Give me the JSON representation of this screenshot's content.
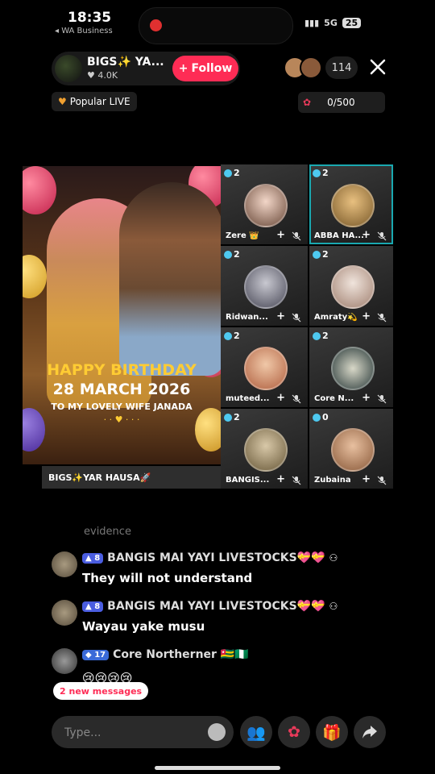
{
  "status_bar": {
    "time": "18:35",
    "back_label": "◂ WA Business",
    "signal": "5G",
    "battery": "25"
  },
  "host": {
    "name": "BIGS✨ YA...",
    "likes": "4.0K",
    "follow_label": "Follow"
  },
  "viewers": {
    "count": "114"
  },
  "popular_badge": "Popular LIVE",
  "rose_goal": "0/500",
  "poster": {
    "title": "HAPPY BIRTHDAY",
    "date": "28 MARCH 2026",
    "subtitle": "TO MY LOVELY WIFE JANADA",
    "host_label": "BIGS✨YAR HAUSA🚀"
  },
  "guests": [
    {
      "gauge": "2",
      "name": "Zere 👑",
      "highlighted": false
    },
    {
      "gauge": "2",
      "name": "ABBA HA...",
      "highlighted": true
    },
    {
      "gauge": "2",
      "name": "Ridwan...",
      "highlighted": false
    },
    {
      "gauge": "2",
      "name": "Amraty💫",
      "highlighted": false
    },
    {
      "gauge": "2",
      "name": "muteed...",
      "highlighted": false
    },
    {
      "gauge": "2",
      "name": "Core N...",
      "highlighted": false
    },
    {
      "gauge": "2",
      "name": "BANGIS...",
      "highlighted": false
    },
    {
      "gauge": "0",
      "name": "Zubaina",
      "highlighted": false
    }
  ],
  "chat": {
    "faded": "evidence",
    "messages": [
      {
        "level": "8",
        "name": "BANGIS MAI YAYI LIVESTOCKS💝💝",
        "text": "They will not understand"
      },
      {
        "level": "8",
        "name": "BANGIS MAI YAYI LIVESTOCKS💝💝",
        "text": "Wayau yake musu"
      },
      {
        "level": "17",
        "name": "Core Northerner 🇹🇬🇳🇬",
        "text": "😢😢😢😢"
      }
    ],
    "new_messages": "2 new messages"
  },
  "input": {
    "placeholder": "Type..."
  },
  "colors": {
    "accent": "#fe2c55",
    "highlight": "#1aa8b0",
    "level_badge": "#4a5de0"
  }
}
